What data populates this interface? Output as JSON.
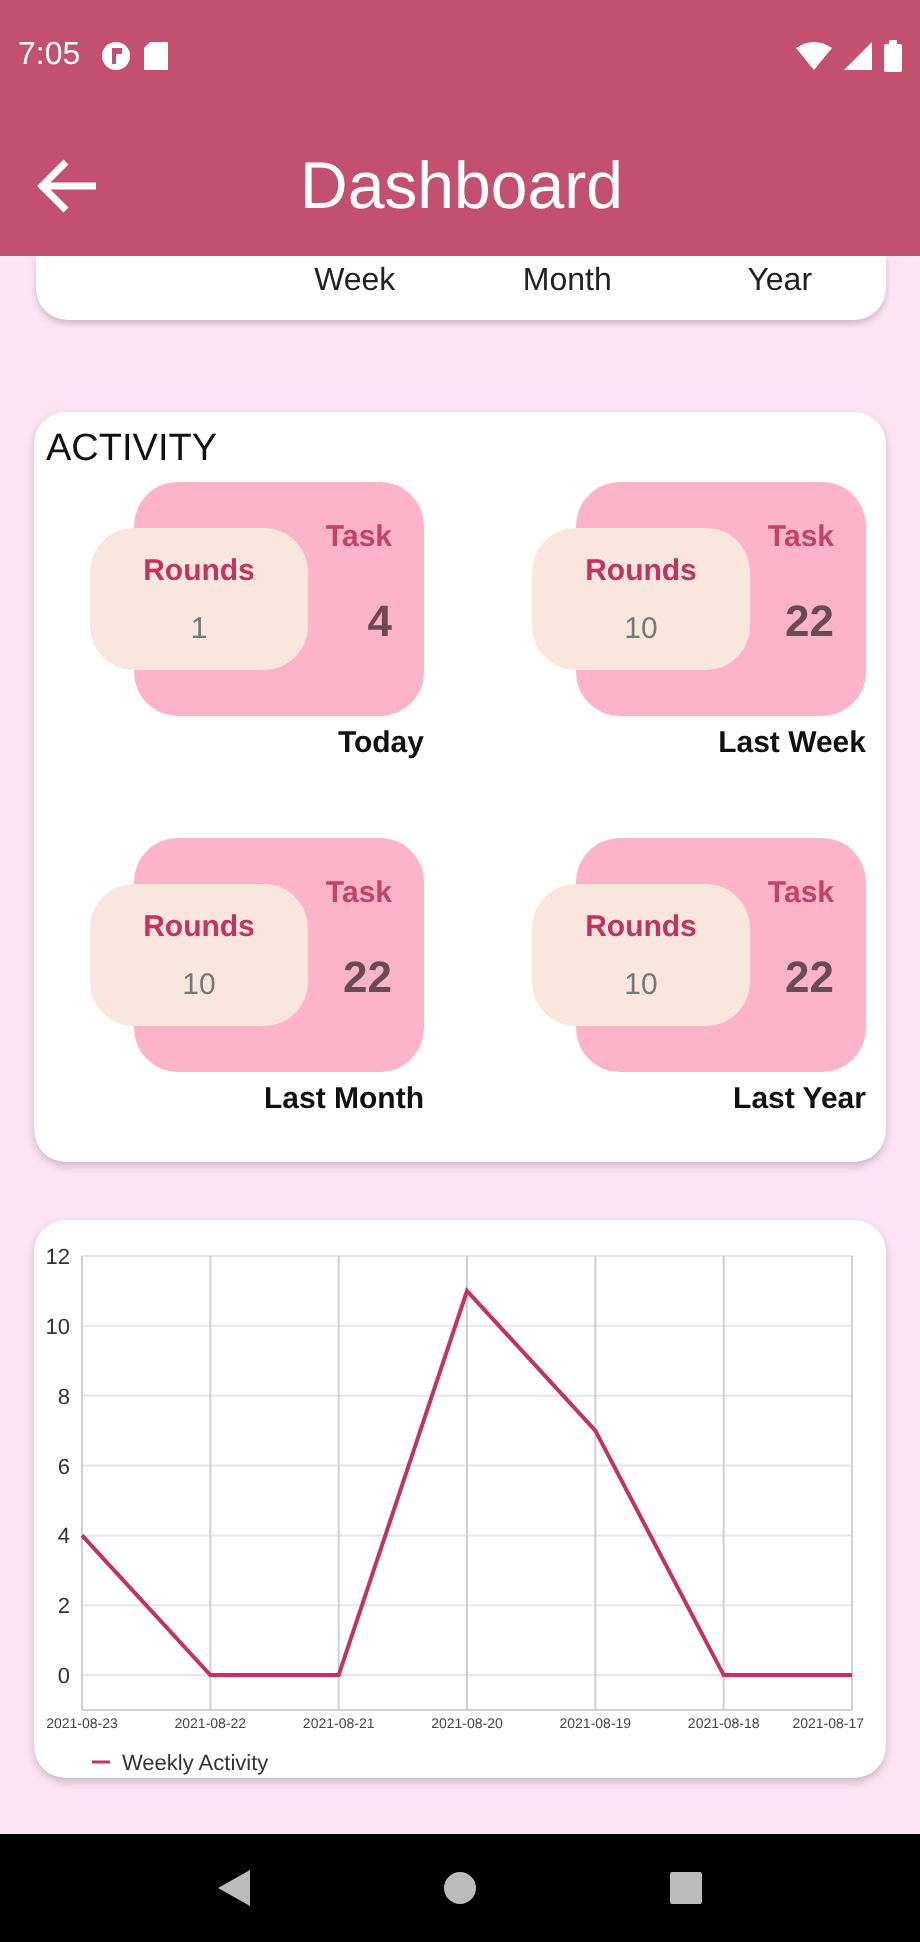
{
  "status_bar": {
    "time": "7:05"
  },
  "app_bar": {
    "title": "Dashboard"
  },
  "period_card": {
    "labels": [
      "Week",
      "Month",
      "Year"
    ]
  },
  "activity": {
    "title": "ACTIVITY",
    "tiles": [
      {
        "rounds_label": "Rounds",
        "rounds": "1",
        "task_label": "Task",
        "task": "4",
        "period": "Today"
      },
      {
        "rounds_label": "Rounds",
        "rounds": "10",
        "task_label": "Task",
        "task": "22",
        "period": "Last Week"
      },
      {
        "rounds_label": "Rounds",
        "rounds": "10",
        "task_label": "Task",
        "task": "22",
        "period": "Last Month"
      },
      {
        "rounds_label": "Rounds",
        "rounds": "10",
        "task_label": "Task",
        "task": "22",
        "period": "Last Year"
      }
    ]
  },
  "weekly_chart": {
    "chart_data": {
      "type": "line",
      "categories": [
        "2021-08-23",
        "2021-08-22",
        "2021-08-21",
        "2021-08-20",
        "2021-08-19",
        "2021-08-18",
        "2021-08-17"
      ],
      "series": [
        {
          "name": "Weekly Activity",
          "color": "#c2335f",
          "values": [
            4,
            0,
            0,
            11,
            7,
            0,
            0
          ]
        }
      ],
      "ylim": [
        -1,
        12
      ],
      "grid": true,
      "yticks": [
        0,
        2,
        4,
        6,
        8,
        10,
        12
      ]
    }
  }
}
